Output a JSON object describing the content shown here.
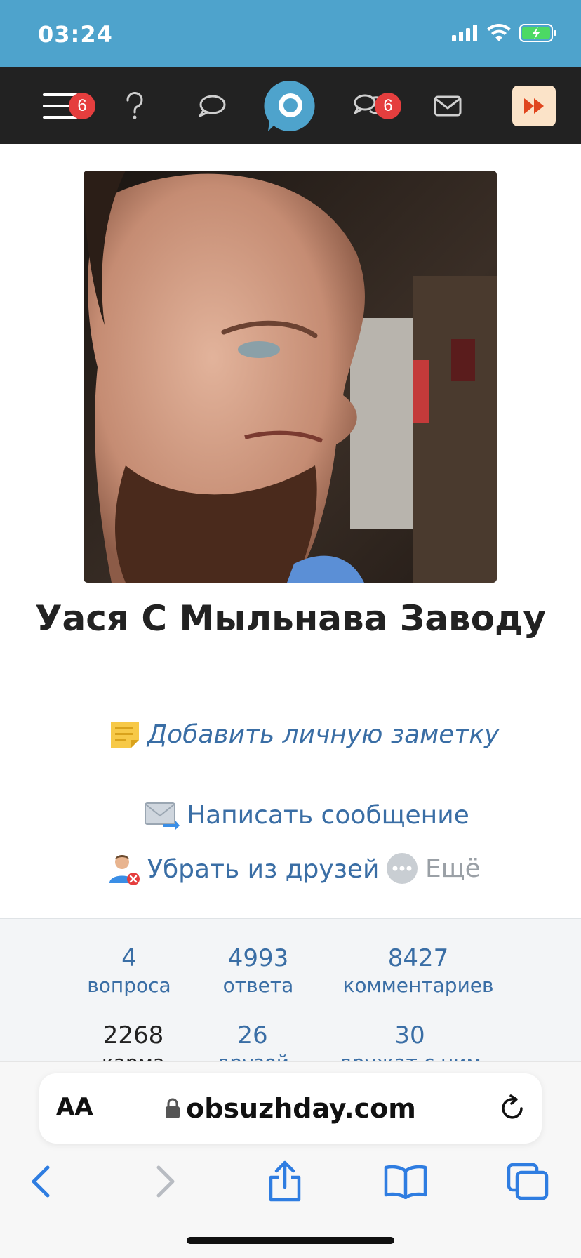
{
  "status": {
    "time": "03:24"
  },
  "nav": {
    "menu_badge": "6",
    "chat_badge": "6"
  },
  "profile": {
    "name": "Уася С Мыльнава Заводу",
    "add_note": "Добавить личную заметку",
    "send_message": "Написать сообщение",
    "remove_friend": "Убрать из друзей",
    "more": "Ещё"
  },
  "stats": [
    {
      "value": "4",
      "label": "вопроса"
    },
    {
      "value": "4993",
      "label": "ответа"
    },
    {
      "value": "8427",
      "label": "комментариев"
    },
    {
      "value": "2268",
      "label": "карма"
    },
    {
      "value": "26",
      "label": "друзей"
    },
    {
      "value": "30",
      "label": "дружат с ним"
    }
  ],
  "browser": {
    "aa_label": "AA",
    "url": "obsuzhday.com"
  },
  "colors": {
    "status_bar": "#4ea3cc",
    "nav_bar": "#222222",
    "link": "#3a6ea5",
    "badge": "#e53e3e"
  }
}
